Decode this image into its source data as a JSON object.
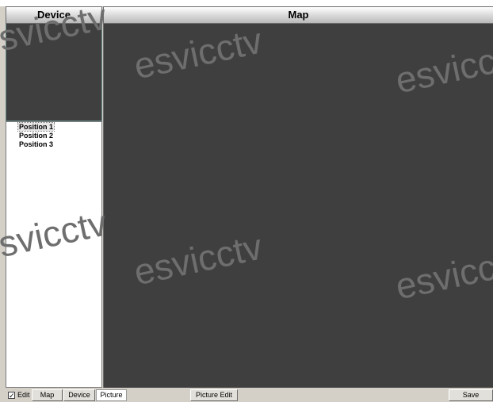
{
  "headers": {
    "device": "Device",
    "map": "Map"
  },
  "device_list": [
    "Position 1",
    "Position 2",
    "Position 3"
  ],
  "selected_index": 0,
  "watermark": "esvicctv",
  "toolbar": {
    "edit_label": "Edit",
    "edit_checked": true,
    "check_mark": "✓",
    "tabs": {
      "map": "Map",
      "device": "Device",
      "picture": "Picture"
    },
    "active_tab": "picture",
    "picture_edit": "Picture Edit",
    "save": "Save"
  },
  "colors": {
    "canvas": "#3f3f3f",
    "panel": "#d4d0c8"
  }
}
